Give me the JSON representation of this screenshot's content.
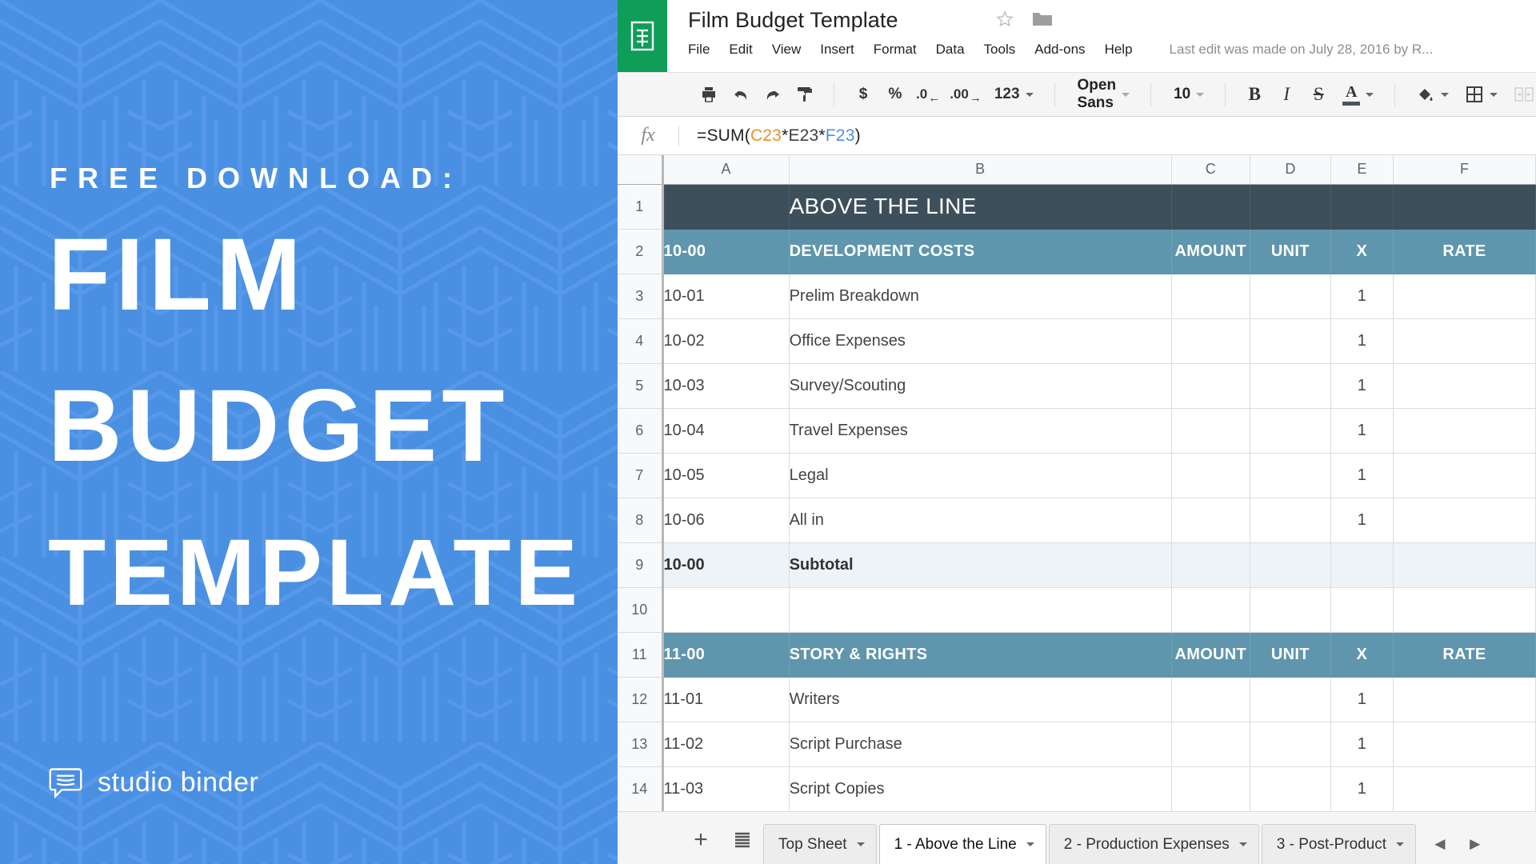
{
  "promo": {
    "eyebrow": "FREE DOWNLOAD:",
    "line1": "FILM",
    "line2": "BUDGET",
    "line3": "TEMPLATE",
    "brand": "studio binder",
    "bg_color": "#4a90e2",
    "logo_icon": "speech-bubble-icon"
  },
  "app": {
    "logo_icon": "sheets-icon",
    "logo_color": "#0f9d58",
    "doc_title": "Film Budget Template",
    "star_icon": "star-outline-icon",
    "folder_icon": "folder-icon",
    "last_edit": "Last edit was made on July 28, 2016 by R...",
    "menus": [
      "File",
      "Edit",
      "View",
      "Insert",
      "Format",
      "Data",
      "Tools",
      "Add-ons",
      "Help"
    ]
  },
  "toolbar": {
    "print": "print-icon",
    "undo": "undo-icon",
    "redo": "redo-icon",
    "paint_format": "paint-format-icon",
    "currency": "$",
    "percent": "%",
    "decrease_decimal": ".0",
    "increase_decimal": ".00",
    "more_formats": "123",
    "font_name": "Open Sans",
    "font_size": "10",
    "bold": "B",
    "italic": "I",
    "strikethrough": "S",
    "text_color": "A",
    "text_color_swatch": "#4a5560",
    "fill_color": "fill-color-icon",
    "borders": "borders-icon",
    "merge_cells": "merge-cells-icon"
  },
  "formula_bar": {
    "fx_label": "fx",
    "formula_prefix": "=SUM(",
    "ref1": "C23",
    "op1": "*",
    "ref2": "E23",
    "op2": "*",
    "ref3": "F23",
    "formula_suffix": ")",
    "ref1_color": "#e8912d",
    "ref2_color": "#3c4043",
    "ref3_color": "#4a90e2"
  },
  "grid": {
    "columns": [
      "A",
      "B",
      "C",
      "D",
      "E",
      "F"
    ],
    "section_color": "#3e4f5c",
    "category_color": "#5f96ad",
    "subtotal_color": "#eef3f7",
    "rows": [
      {
        "n": "1",
        "type": "section",
        "a": "",
        "b": "ABOVE THE LINE",
        "c": "",
        "d": "",
        "e": "",
        "f": ""
      },
      {
        "n": "2",
        "type": "cat",
        "a": "10-00",
        "b": "DEVELOPMENT COSTS",
        "c": "AMOUNT",
        "d": "UNIT",
        "e": "X",
        "f": "RATE"
      },
      {
        "n": "3",
        "type": "data",
        "a": "10-01",
        "b": "Prelim Breakdown",
        "c": "",
        "d": "",
        "e": "1",
        "f": ""
      },
      {
        "n": "4",
        "type": "data",
        "a": "10-02",
        "b": "Office Expenses",
        "c": "",
        "d": "",
        "e": "1",
        "f": ""
      },
      {
        "n": "5",
        "type": "data",
        "a": "10-03",
        "b": "Survey/Scouting",
        "c": "",
        "d": "",
        "e": "1",
        "f": ""
      },
      {
        "n": "6",
        "type": "data",
        "a": "10-04",
        "b": "Travel Expenses",
        "c": "",
        "d": "",
        "e": "1",
        "f": ""
      },
      {
        "n": "7",
        "type": "data",
        "a": "10-05",
        "b": "Legal",
        "c": "",
        "d": "",
        "e": "1",
        "f": ""
      },
      {
        "n": "8",
        "type": "data",
        "a": "10-06",
        "b": "All in",
        "c": "",
        "d": "",
        "e": "1",
        "f": ""
      },
      {
        "n": "9",
        "type": "sub",
        "a": "10-00",
        "b": "Subtotal",
        "c": "",
        "d": "",
        "e": "",
        "f": ""
      },
      {
        "n": "10",
        "type": "blank",
        "a": "",
        "b": "",
        "c": "",
        "d": "",
        "e": "",
        "f": ""
      },
      {
        "n": "11",
        "type": "cat",
        "a": "11-00",
        "b": "STORY & RIGHTS",
        "c": "AMOUNT",
        "d": "UNIT",
        "e": "X",
        "f": "RATE"
      },
      {
        "n": "12",
        "type": "data",
        "a": "11-01",
        "b": "Writers",
        "c": "",
        "d": "",
        "e": "1",
        "f": ""
      },
      {
        "n": "13",
        "type": "data",
        "a": "11-02",
        "b": "Script Purchase",
        "c": "",
        "d": "",
        "e": "1",
        "f": ""
      },
      {
        "n": "14",
        "type": "data",
        "a": "11-03",
        "b": "Script Copies",
        "c": "",
        "d": "",
        "e": "1",
        "f": ""
      }
    ]
  },
  "tabbar": {
    "add_sheet": "+",
    "all_sheets": "all-sheets-icon",
    "tabs": [
      {
        "label": "Top Sheet",
        "active": false
      },
      {
        "label": "1 - Above the Line",
        "active": true
      },
      {
        "label": "2 - Production Expenses",
        "active": false
      },
      {
        "label": "3 - Post-Product",
        "active": false
      }
    ],
    "prev_icon": "chevron-left-icon",
    "next_icon": "chevron-right-icon"
  }
}
